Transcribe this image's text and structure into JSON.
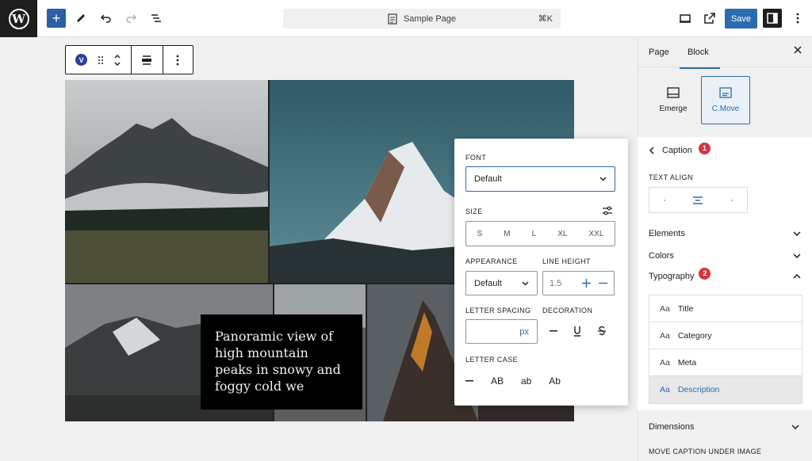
{
  "topbar": {
    "document_title": "Sample Page",
    "shortcut": "⌘K",
    "save_label": "Save"
  },
  "block_toolbar": {
    "badge": "V"
  },
  "caption_text": "Panoramic view of high mountain peaks in snowy and foggy cold we",
  "popover": {
    "font_label": "FONT",
    "font_value": "Default",
    "size_label": "SIZE",
    "sizes": [
      "S",
      "M",
      "L",
      "XL",
      "XXL"
    ],
    "appearance_label": "APPEARANCE",
    "appearance_value": "Default",
    "line_height_label": "LINE HEIGHT",
    "line_height_value": "1.5",
    "letter_spacing_label": "LETTER SPACING",
    "letter_spacing_unit": "px",
    "decoration_label": "DECORATION",
    "letter_case_label": "LETTER CASE",
    "letter_case_options": [
      "AB",
      "ab",
      "Ab"
    ]
  },
  "sidebar": {
    "tabs": [
      "Page",
      "Block"
    ],
    "styles": [
      "Emerge",
      "C.Move"
    ],
    "caption_title": "Caption",
    "caption_badge": "1",
    "text_align_label": "TEXT ALIGN",
    "elements_label": "Elements",
    "colors_label": "Colors",
    "typography_label": "Typography",
    "typography_badge": "2",
    "typography_items": [
      "Title",
      "Category",
      "Meta",
      "Description"
    ],
    "typo_prefix": "Aa",
    "dimensions_label": "Dimensions",
    "move_caption_label": "MOVE CAPTION UNDER IMAGE"
  },
  "colors": {
    "accent": "#2b6cb0",
    "badge": "#d6343e"
  }
}
